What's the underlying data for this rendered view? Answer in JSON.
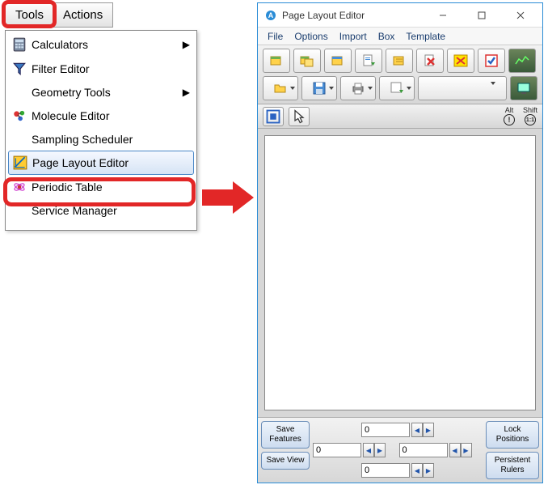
{
  "menu": {
    "tabs": {
      "tools": "Tools",
      "actions": "Actions"
    },
    "items": {
      "calculators": "Calculators",
      "filterEditor": "Filter Editor",
      "geometryTools": "Geometry Tools",
      "moleculeEditor": "Molecule Editor",
      "samplingScheduler": "Sampling Scheduler",
      "pageLayoutEditor": "Page Layout Editor",
      "periodicTable": "Periodic Table",
      "serviceManager": "Service Manager"
    }
  },
  "window": {
    "title": "Page Layout Editor",
    "menubar": {
      "file": "File",
      "options": "Options",
      "import": "Import",
      "box": "Box",
      "template": "Template"
    },
    "spin": {
      "top": "0",
      "left": "0",
      "right": "0",
      "bottom": "0"
    },
    "buttons": {
      "saveFeatures": "Save Features",
      "saveView": "Save View",
      "lockPositions": "Lock Positions",
      "persistentRulers": "Persistent Rulers"
    },
    "mods": {
      "alt": "Alt",
      "shift": "Shift",
      "altSym": "!",
      "shiftSym": "1:1"
    }
  }
}
